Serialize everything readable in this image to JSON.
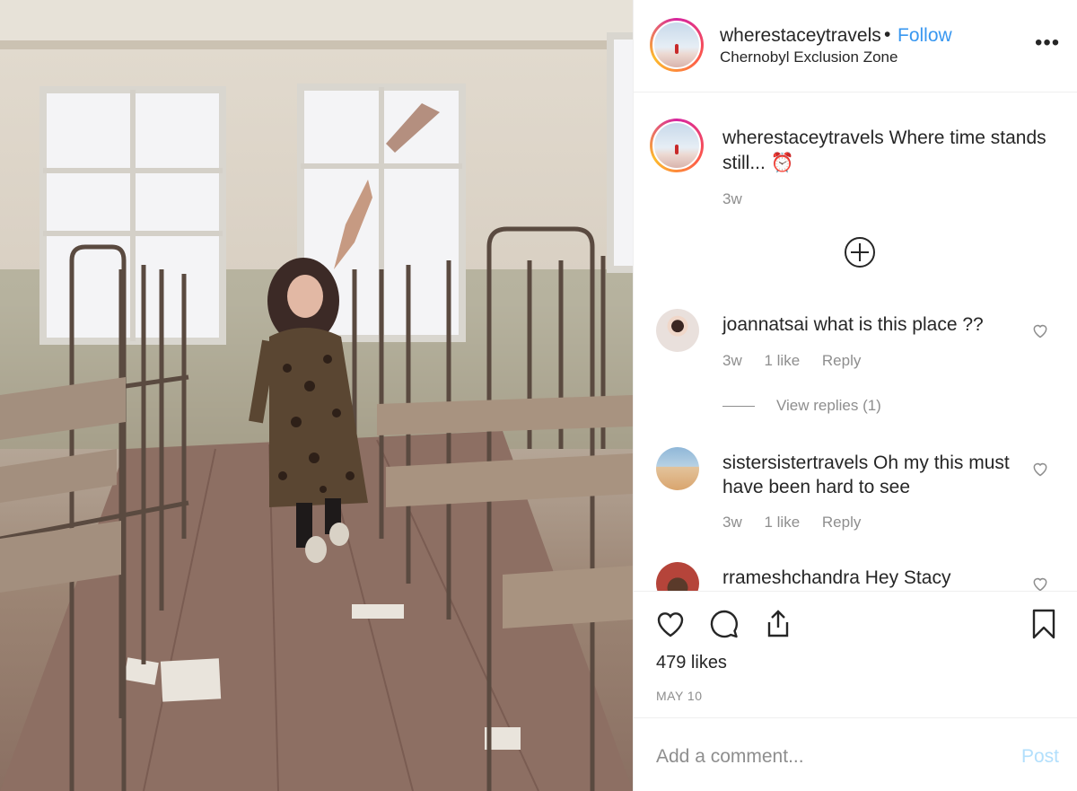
{
  "post": {
    "username": "wherestaceytravels",
    "separator": "•",
    "follow_label": "Follow",
    "location": "Chernobyl Exclusion Zone",
    "more_icon": "more-options-icon",
    "caption": "Where time stands still...",
    "caption_emoji": "⏰",
    "caption_time": "3w",
    "load_more_icon": "plus-circle-icon",
    "likes": "479 likes",
    "date": "MAY 10",
    "comment_placeholder": "Add a comment...",
    "post_label": "Post"
  },
  "comments": [
    {
      "username": "joannatsai",
      "text": "what is this place ??",
      "time": "3w",
      "likes": "1 like",
      "reply": "Reply",
      "view_replies": "View replies (1)"
    },
    {
      "username": "sistersistertravels",
      "text": "Oh my this must have been hard to see",
      "time": "3w",
      "likes": "1 like",
      "reply": "Reply"
    },
    {
      "username": "rrameshchandra",
      "text": "Hey Stacy"
    }
  ],
  "colors": {
    "link": "#3897f0",
    "muted": "#8e8e8e",
    "post_disabled": "#b2dffc",
    "border": "#efefef"
  }
}
